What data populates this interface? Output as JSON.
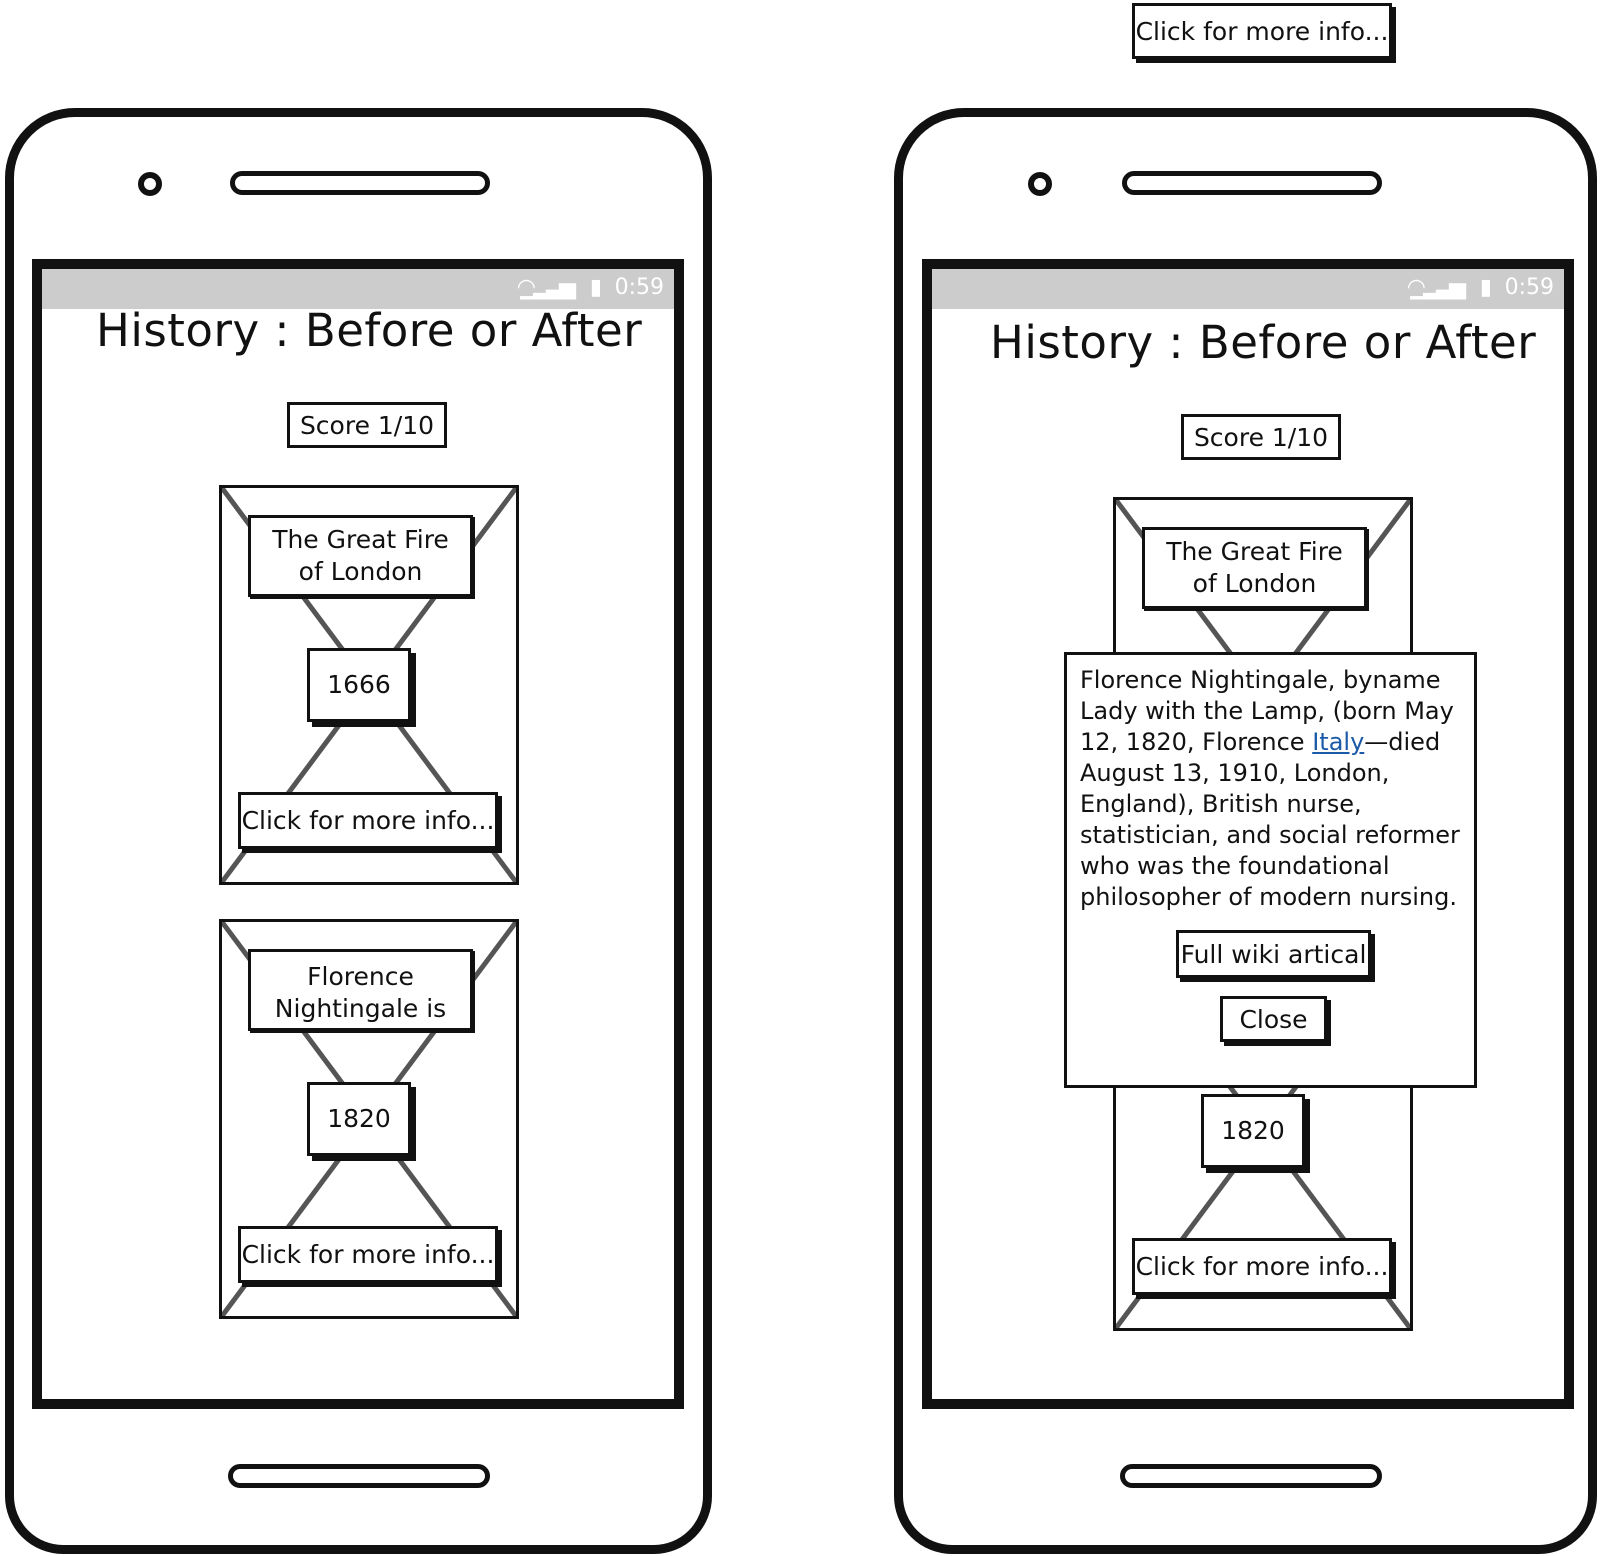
{
  "status": {
    "time": "0:59",
    "wifi_icon": "wifi-icon",
    "signal_icon": "signal-icon",
    "battery_icon": "battery-icon"
  },
  "app_title": "History : Before or After",
  "score": "Score 1/10",
  "top_floating_button": "Click for more info...",
  "left_phone": {
    "cards": [
      {
        "event": "The Great Fire of London",
        "year": "1666",
        "info_button": "Click for more info..."
      },
      {
        "event": "Florence Nightingale is Born",
        "year": "1820",
        "info_button": "Click for more info..."
      }
    ]
  },
  "right_phone": {
    "card_top": {
      "event": "The Great Fire of London"
    },
    "card_bottom": {
      "year": "1820",
      "info_button": "Click for more info..."
    },
    "popup": {
      "text_before_link": "Florence Nightingale, byname Lady with the Lamp, (born May 12, 1820, Florence ",
      "link_text": "Italy",
      "text_after_link": "—died August 13, 1910, London, England), British nurse, statistician, and social reformer who was the foundational philosopher of modern nursing.",
      "wiki_button": "Full wiki artical",
      "close_button": "Close"
    }
  }
}
